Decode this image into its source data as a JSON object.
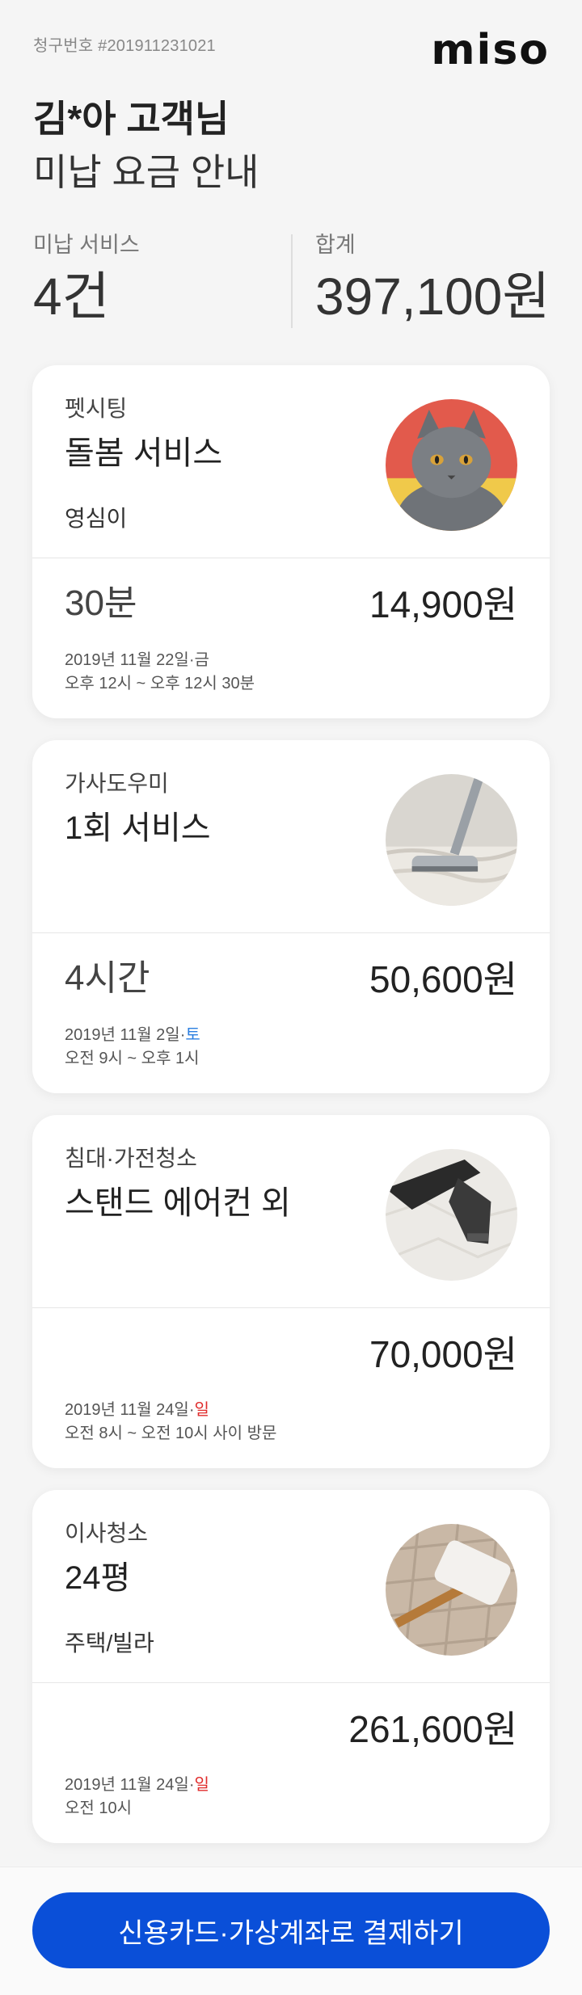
{
  "header": {
    "invoice_number": "청구번호 #201911231021",
    "logo": "miso",
    "customer": "김*아 고객님",
    "subtitle": "미납 요금 안내"
  },
  "summary": {
    "unpaid_label": "미납 서비스",
    "unpaid_value": "4건",
    "total_label": "합계",
    "total_value": "397,100원"
  },
  "cards": [
    {
      "category": "펫시팅",
      "title": "돌봄 서비스",
      "sub": "영심이",
      "duration": "30분",
      "price": "14,900원",
      "date": "2019년 11월 22일·",
      "day": "금",
      "time": "오후 12시 ~ 오후 12시 30분",
      "photo_icon": "cat-photo-icon"
    },
    {
      "category": "가사도우미",
      "title": "1회 서비스",
      "sub": "",
      "duration": "4시간",
      "price": "50,600원",
      "date": "2019년 11월 2일·",
      "day": "토",
      "time": "오전 9시 ~ 오후 1시",
      "photo_icon": "vacuum-photo-icon"
    },
    {
      "category": "침대·가전청소",
      "title": "스탠드 에어컨 외",
      "sub": "",
      "duration": "",
      "price": "70,000원",
      "date": "2019년 11월 24일·",
      "day": "일",
      "time": "오전 8시 ~ 오전 10시 사이 방문",
      "photo_icon": "mattress-cleaner-photo-icon"
    },
    {
      "category": "이사청소",
      "title": "24평",
      "sub": "주택/빌라",
      "duration": "",
      "price": "261,600원",
      "date": "2019년 11월 24일·",
      "day": "일",
      "time": "오전 10시",
      "photo_icon": "mop-photo-icon"
    }
  ],
  "colors": {
    "brand_blue": "#0a4fd8",
    "saturday": "#2b7fe0",
    "sunday": "#e02b2b"
  },
  "pay_button": {
    "label": "신용카드·가상계좌로 결제하기"
  }
}
